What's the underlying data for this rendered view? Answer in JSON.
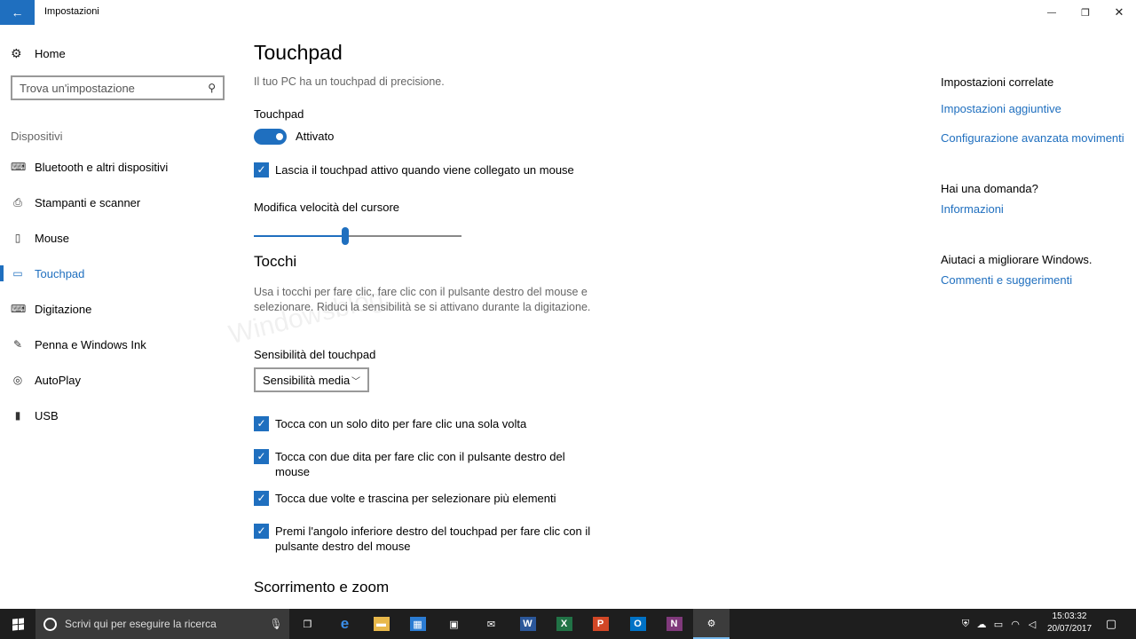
{
  "window": {
    "title": "Impostazioni",
    "back_glyph": "←",
    "minimize_glyph": "—",
    "maximize_glyph": "❐",
    "close_glyph": "✕"
  },
  "sidebar": {
    "home_label": "Home",
    "search_placeholder": "Trova un'impostazione",
    "section_label": "Dispositivi",
    "items": [
      {
        "label": "Bluetooth e altri dispositivi",
        "icon": "bluetooth-devices-icon",
        "glyph": "⌨"
      },
      {
        "label": "Stampanti e scanner",
        "icon": "printer-icon",
        "glyph": "⎙"
      },
      {
        "label": "Mouse",
        "icon": "mouse-icon",
        "glyph": "▯"
      },
      {
        "label": "Touchpad",
        "icon": "touchpad-icon",
        "glyph": "▭"
      },
      {
        "label": "Digitazione",
        "icon": "keyboard-icon",
        "glyph": "⌨"
      },
      {
        "label": "Penna e Windows Ink",
        "icon": "pen-icon",
        "glyph": "✎"
      },
      {
        "label": "AutoPlay",
        "icon": "autoplay-icon",
        "glyph": "◎"
      },
      {
        "label": "USB",
        "icon": "usb-icon",
        "glyph": "▮"
      }
    ],
    "active_index": 3
  },
  "main": {
    "title": "Touchpad",
    "subtitle": "Il tuo PC ha un touchpad di precisione.",
    "touchpad_label": "Touchpad",
    "toggle_state": "Attivato",
    "keep_active_label": "Lascia il touchpad attivo quando viene collegato un mouse",
    "cursor_speed_label": "Modifica velocità del cursore",
    "cursor_speed_value": 0.44,
    "taps_heading": "Tocchi",
    "taps_description": "Usa i tocchi per fare clic, fare clic con il pulsante destro del mouse e selezionare. Riduci la sensibilità se si attivano durante la digitazione.",
    "sensitivity_label": "Sensibilità del touchpad",
    "sensitivity_value": "Sensibilità media",
    "tap_options": [
      "Tocca con un solo dito per fare clic una sola volta",
      "Tocca con due dita per fare clic con il pulsante destro del mouse",
      "Tocca due volte e trascina per selezionare più elementi",
      "Premi l'angolo inferiore destro del touchpad per fare clic con il pulsante destro del mouse"
    ],
    "scroll_heading": "Scorrimento e zoom"
  },
  "related": {
    "heading": "Impostazioni correlate",
    "link1": "Impostazioni aggiuntive",
    "link2": "Configurazione avanzata movimenti",
    "question": "Hai una domanda?",
    "link3": "Informazioni",
    "improve": "Aiutaci a migliorare Windows.",
    "link4": "Commenti e suggerimenti"
  },
  "watermark": "Windowsblog",
  "taskbar": {
    "search_placeholder": "Scrivi qui per eseguire la ricerca",
    "apps": [
      {
        "name": "task-view-icon",
        "glyph": "❐",
        "color": "#1e1e1e"
      },
      {
        "name": "edge-icon",
        "glyph": "e",
        "color": "#1e1e1e"
      },
      {
        "name": "file-explorer-icon",
        "glyph": "▬",
        "color": "#e8b84a"
      },
      {
        "name": "calculator-icon",
        "glyph": "▦",
        "color": "#2b7cd3"
      },
      {
        "name": "store-icon",
        "glyph": "▣",
        "color": "#1e1e1e"
      },
      {
        "name": "mail-icon",
        "glyph": "✉",
        "color": "#1e1e1e"
      },
      {
        "name": "word-icon",
        "glyph": "W",
        "color": "#2b579a"
      },
      {
        "name": "excel-icon",
        "glyph": "X",
        "color": "#217346"
      },
      {
        "name": "powerpoint-icon",
        "glyph": "P",
        "color": "#d24726"
      },
      {
        "name": "outlook-icon",
        "glyph": "O",
        "color": "#0072c6"
      },
      {
        "name": "onenote-icon",
        "glyph": "N",
        "color": "#80397b"
      },
      {
        "name": "settings-icon",
        "glyph": "⚙",
        "color": "#3c3c3c"
      }
    ],
    "time": "15:03:32",
    "date": "20/07/2017"
  }
}
